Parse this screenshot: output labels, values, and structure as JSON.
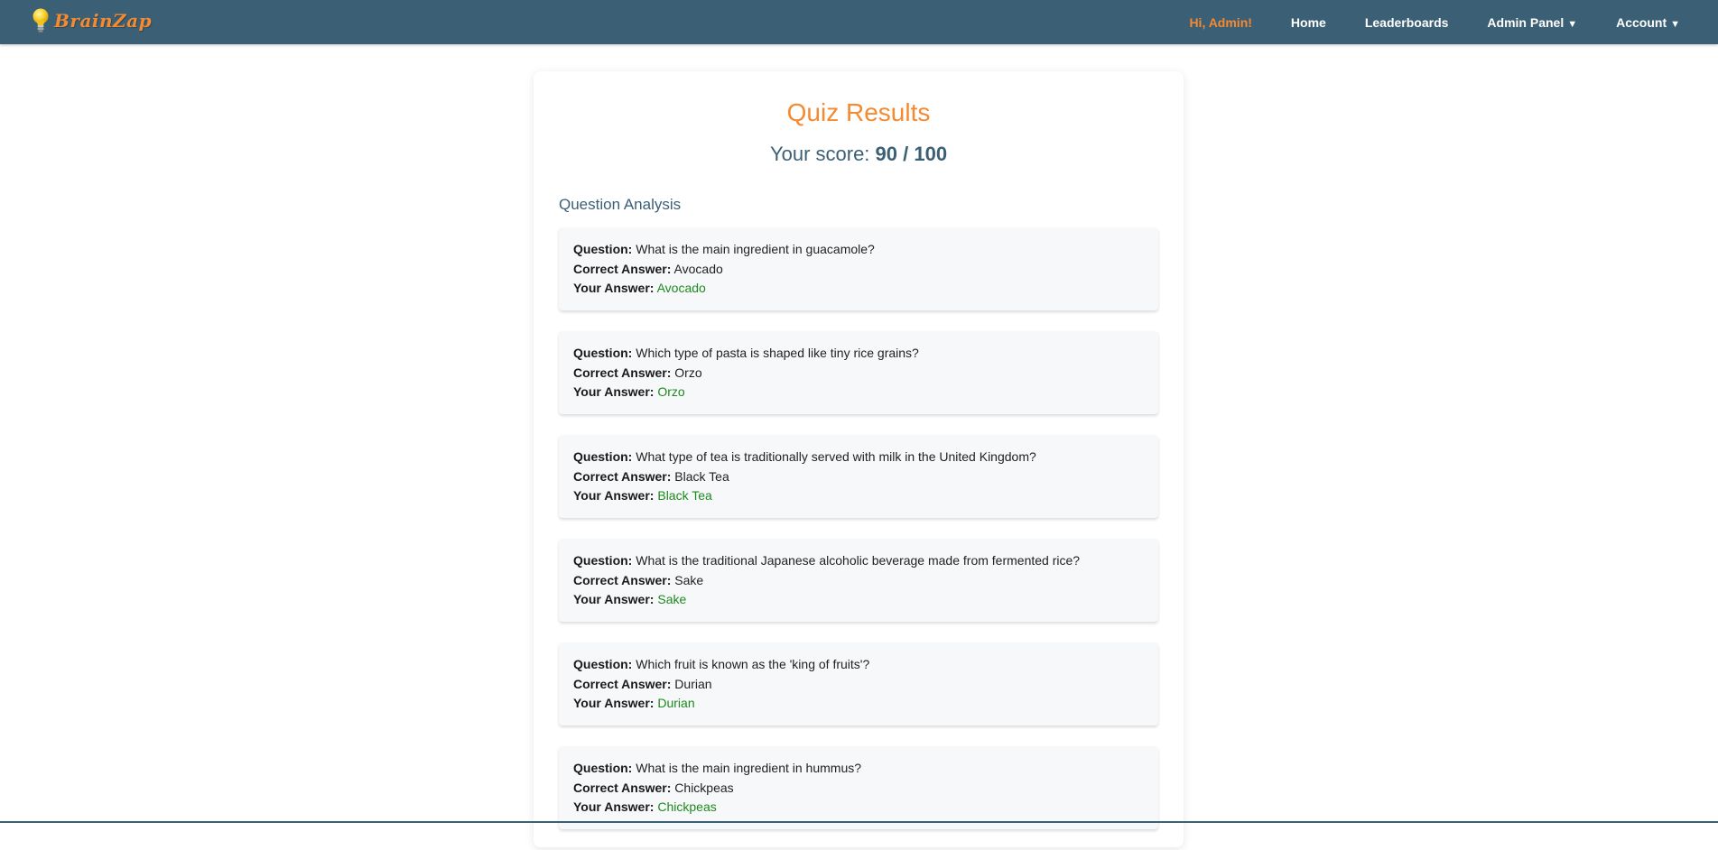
{
  "colors": {
    "navbar_bg": "#3b6075",
    "accent": "#f58a31",
    "correct": "#1e8a1e"
  },
  "brand": {
    "name": "BrainZap",
    "icon": "lightbulb-icon"
  },
  "nav": {
    "greeting": "Hi, Admin!",
    "home": "Home",
    "leaderboards": "Leaderboards",
    "admin_panel": "Admin Panel",
    "account": "Account",
    "caret": "▼"
  },
  "main": {
    "title": "Quiz Results",
    "score_prefix": "Your score:",
    "score_value": "90 / 100",
    "section_title": "Question Analysis"
  },
  "labels": {
    "question": "Question:",
    "correct_answer": "Correct Answer:",
    "your_answer": "Your Answer:"
  },
  "questions": [
    {
      "question": "What is the main ingredient in guacamole?",
      "correct_answer": "Avocado",
      "your_answer": "Avocado"
    },
    {
      "question": "Which type of pasta is shaped like tiny rice grains?",
      "correct_answer": "Orzo",
      "your_answer": "Orzo"
    },
    {
      "question": "What type of tea is traditionally served with milk in the United Kingdom?",
      "correct_answer": "Black Tea",
      "your_answer": "Black Tea"
    },
    {
      "question": "What is the traditional Japanese alcoholic beverage made from fermented rice?",
      "correct_answer": "Sake",
      "your_answer": "Sake"
    },
    {
      "question": "Which fruit is known as the 'king of fruits'?",
      "correct_answer": "Durian",
      "your_answer": "Durian"
    },
    {
      "question": "What is the main ingredient in hummus?",
      "correct_answer": "Chickpeas",
      "your_answer": "Chickpeas"
    }
  ]
}
